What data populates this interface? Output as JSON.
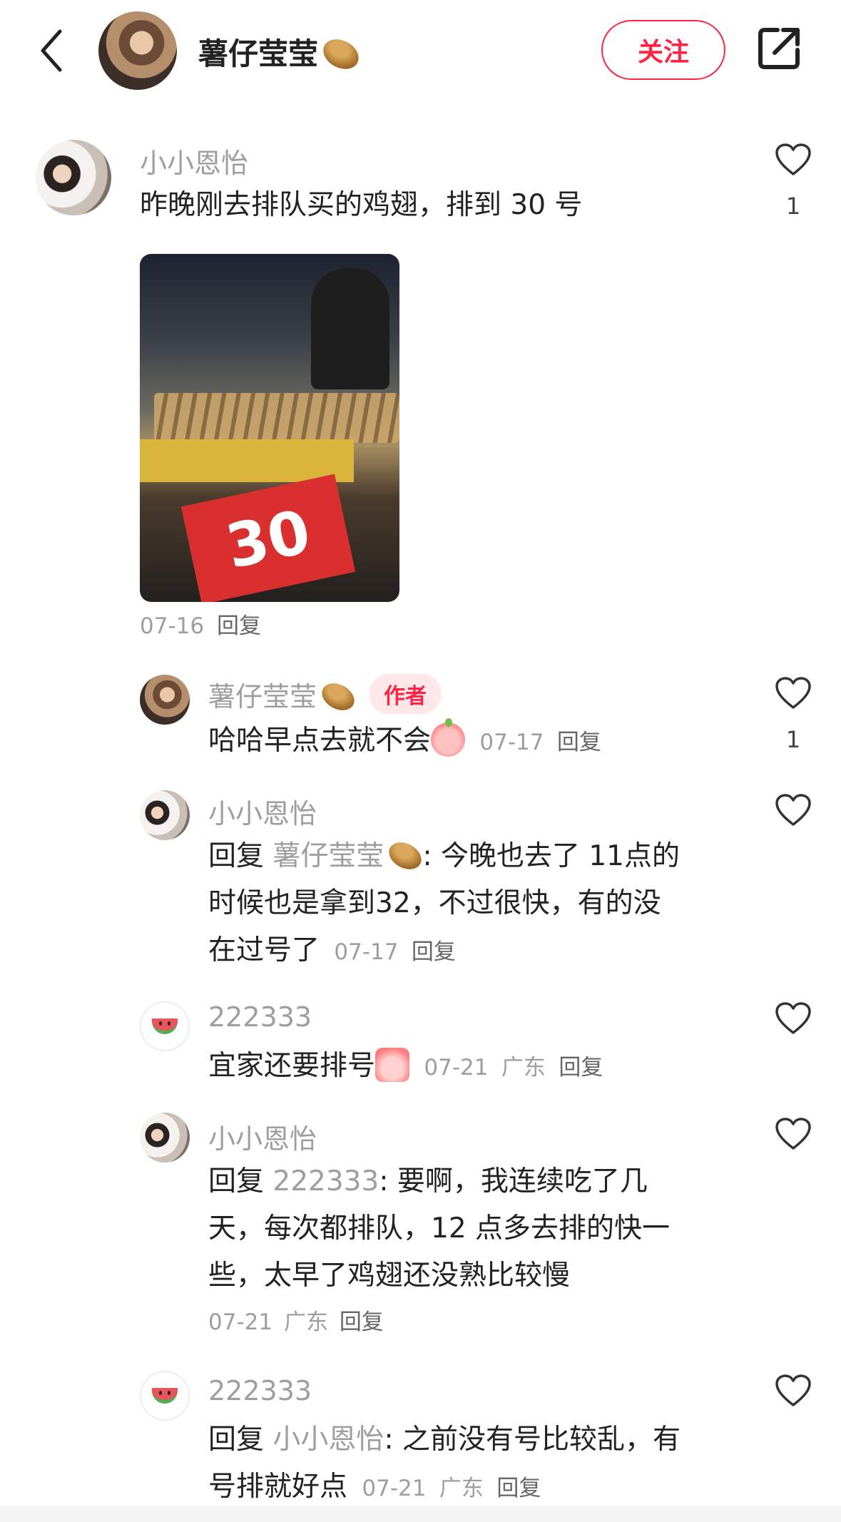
{
  "header": {
    "name": "薯仔莹莹",
    "follow_label": "关注"
  },
  "comments": [
    {
      "name": "小小恩怡",
      "text": "昨晚刚去排队买的鸡翅，排到 30 号",
      "photo_label": "30",
      "date": "07-16",
      "reply_label": "回复",
      "likes": "1"
    }
  ],
  "replies": [
    {
      "name": "薯仔莹莹",
      "tag": "作者",
      "text": "哈哈早点去就不会",
      "date": "07-17",
      "reply_label": "回复",
      "likes": "1"
    },
    {
      "name": "小小恩怡",
      "prefix": "回复",
      "reply_to": "薯仔莹莹",
      "text_1": ": 今晚也去了 11点的",
      "text_2": "时候也是拿到32，不过很快，有的没",
      "text_3": "在过号了",
      "date": "07-17",
      "reply_label": "回复"
    },
    {
      "name": "222333",
      "text": "宜家还要排号",
      "date": "07-21",
      "location": "广东",
      "reply_label": "回复"
    },
    {
      "name": "小小恩怡",
      "prefix": "回复",
      "reply_to": "222333",
      "text_1": ": 要啊，我连续吃了几",
      "text_2": "天，每次都排队，12 点多去排的快一",
      "text_3": "些，太早了鸡翅还没熟比较慢",
      "date": "07-21",
      "location": "广东",
      "reply_label": "回复"
    },
    {
      "name": "222333",
      "prefix": "回复",
      "reply_to": "小小恩怡",
      "text_1": ": 之前没有号比较乱，有",
      "text_2": "号排就好点",
      "date": "07-21",
      "location": "广东",
      "reply_label": "回复"
    }
  ],
  "icons": {
    "back": "chevron-left-icon",
    "share": "share-icon",
    "like": "heart-outline-icon"
  },
  "colors": {
    "accent": "#ff2442",
    "muted": "#9e9e9e",
    "text": "#222222"
  }
}
